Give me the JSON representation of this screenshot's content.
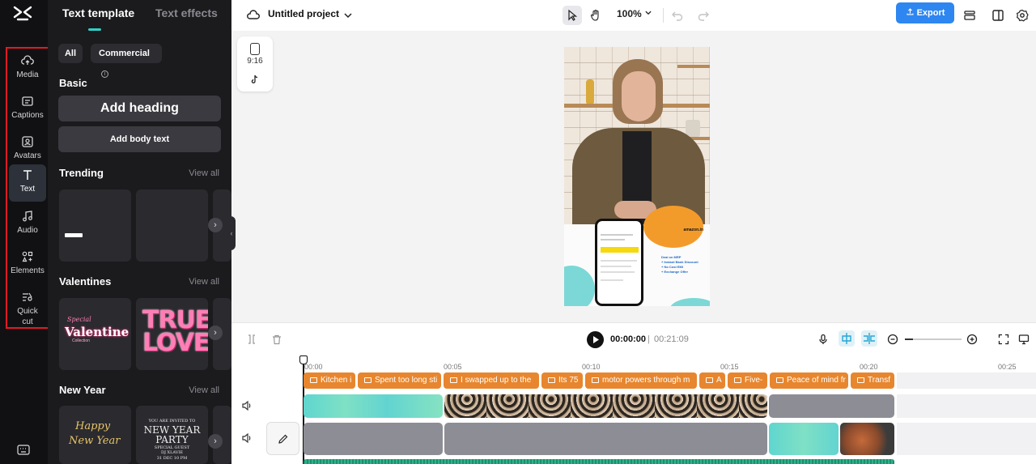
{
  "sidebar": {
    "items": [
      {
        "label": "Media",
        "icon": "cloud-upload-icon"
      },
      {
        "label": "Captions",
        "icon": "captions-icon"
      },
      {
        "label": "Avatars",
        "icon": "avatar-icon"
      },
      {
        "label": "Text",
        "icon": "text-icon"
      },
      {
        "label": "Audio",
        "icon": "music-note-icon"
      },
      {
        "label": "Elements",
        "icon": "elements-icon"
      },
      {
        "label": "Quick\ncut",
        "icon": "quick-cut-icon"
      }
    ],
    "active": "Text"
  },
  "panel": {
    "tabs": [
      "Text template",
      "Text effects"
    ],
    "filters": [
      "All",
      "Commercial"
    ],
    "basic": {
      "title": "Basic",
      "heading_btn": "Add heading",
      "body_btn": "Add body text"
    },
    "trending": {
      "title": "Trending",
      "view_all": "View all"
    },
    "valentines": {
      "title": "Valentines",
      "view_all": "View all",
      "card1_script": "Special",
      "card1_title": "Valentine",
      "card1_sub": "Collection",
      "card2_text": "TRUE LOVE"
    },
    "new_year": {
      "title": "New Year",
      "view_all": "View all",
      "card1_line1": "Happy",
      "card1_line2": "New Year",
      "card2_line1": "YOU ARE INVITED TO",
      "card2_line2": "NEW YEAR",
      "card2_line3": "PARTY",
      "card2_line4": "SPECIAL GUEST",
      "card2_line5": "DJ XLAVIE",
      "card2_line6": "31 DEC 10 PM"
    }
  },
  "topbar": {
    "project_title": "Untitled project",
    "zoom": "100%",
    "export_label": "Export"
  },
  "canvas": {
    "ratio_label": "9:16",
    "ad_brand": "amazon.in",
    "ad_lines": [
      "Deal on MRP",
      "+ Instant Bank Discount",
      "+ No Cost EMI",
      "+ Exchange Offer"
    ]
  },
  "timeline": {
    "current_time": "00:00:00",
    "separator": "|",
    "total_time": "00:21:09",
    "ruler": [
      "00:00",
      "00:05",
      "00:10",
      "00:15",
      "00:20",
      "00:25"
    ],
    "captions": [
      "Kitchen i",
      "Spent too long sti",
      "I swapped up to the",
      "Its 75",
      "motor powers through m",
      "A",
      "Five-",
      "Peace of mind fr",
      "Transf"
    ]
  },
  "colors": {
    "accent": "#2e86f0",
    "caption_clip": "#e7862e",
    "highlight_box": "#e01b24",
    "tab_underline": "#2fd1c7"
  }
}
